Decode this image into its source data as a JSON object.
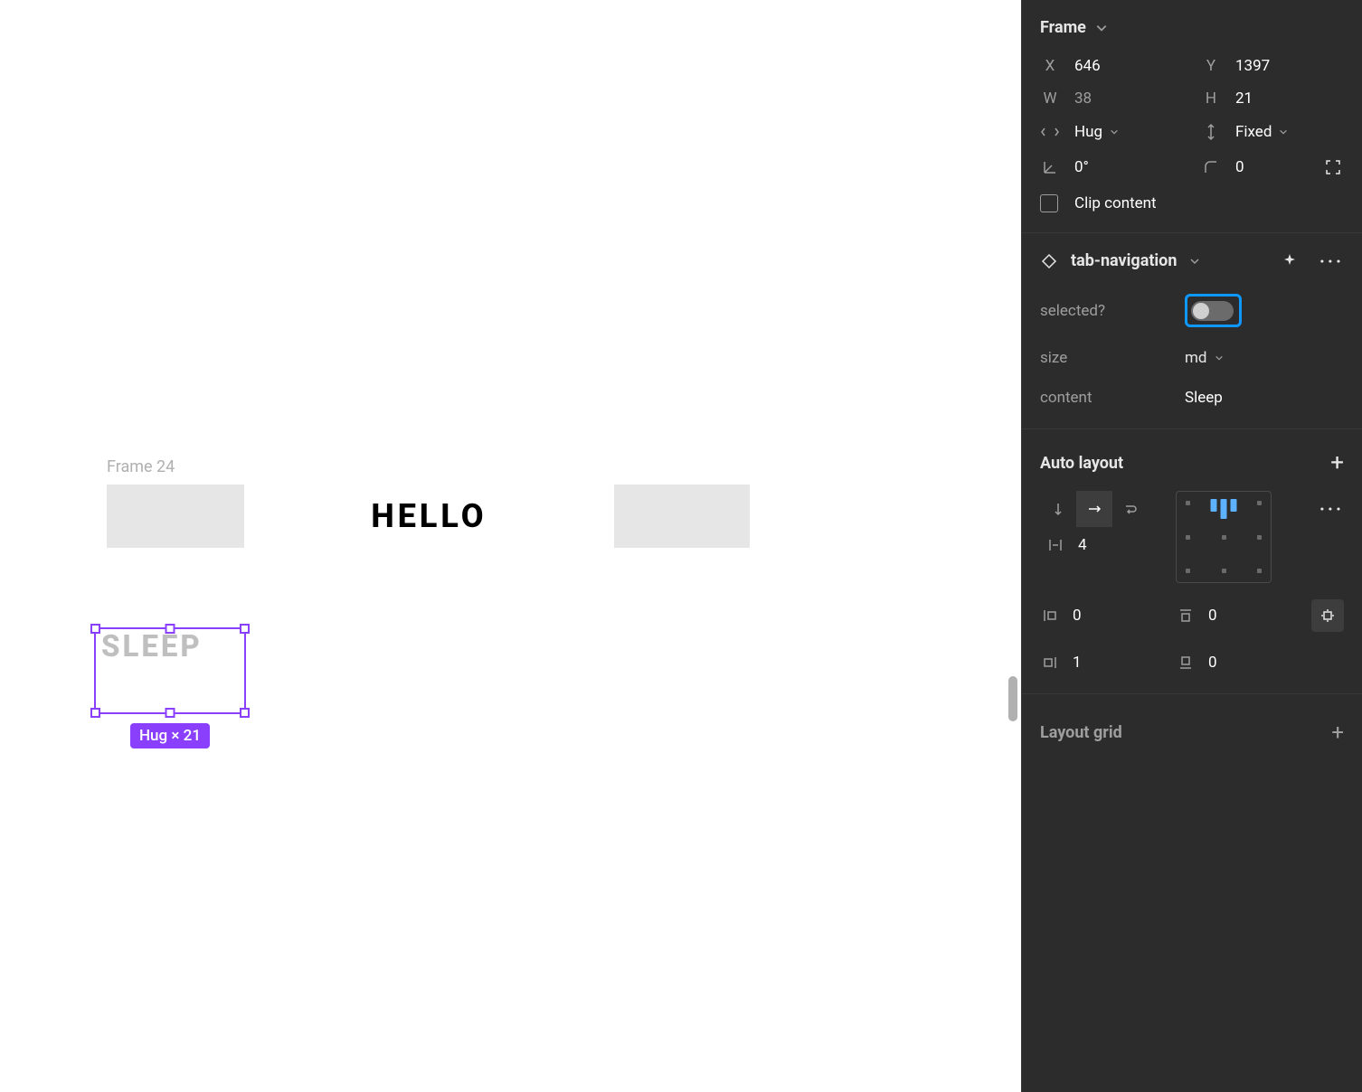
{
  "canvas": {
    "frame_label": "Frame 24",
    "center_text": "HELLO",
    "selection_text": "SLEEP",
    "selection_badge": "Hug × 21"
  },
  "frame_section": {
    "title": "Frame",
    "x_label": "X",
    "x_value": "646",
    "y_label": "Y",
    "y_value": "1397",
    "w_label": "W",
    "w_value": "38",
    "h_label": "H",
    "h_value": "21",
    "h_sizing": "Hug",
    "v_sizing": "Fixed",
    "rotation": "0°",
    "corner_radius": "0",
    "clip_label": "Clip content"
  },
  "component": {
    "name": "tab-navigation",
    "prop_selected_label": "selected?",
    "prop_size_label": "size",
    "prop_size_value": "md",
    "prop_content_label": "content",
    "prop_content_value": "Sleep"
  },
  "auto_layout": {
    "title": "Auto layout",
    "gap": "4",
    "pad_left": "0",
    "pad_top": "0",
    "pad_right": "1",
    "pad_bottom": "0"
  },
  "layout_grid": {
    "title": "Layout grid"
  }
}
